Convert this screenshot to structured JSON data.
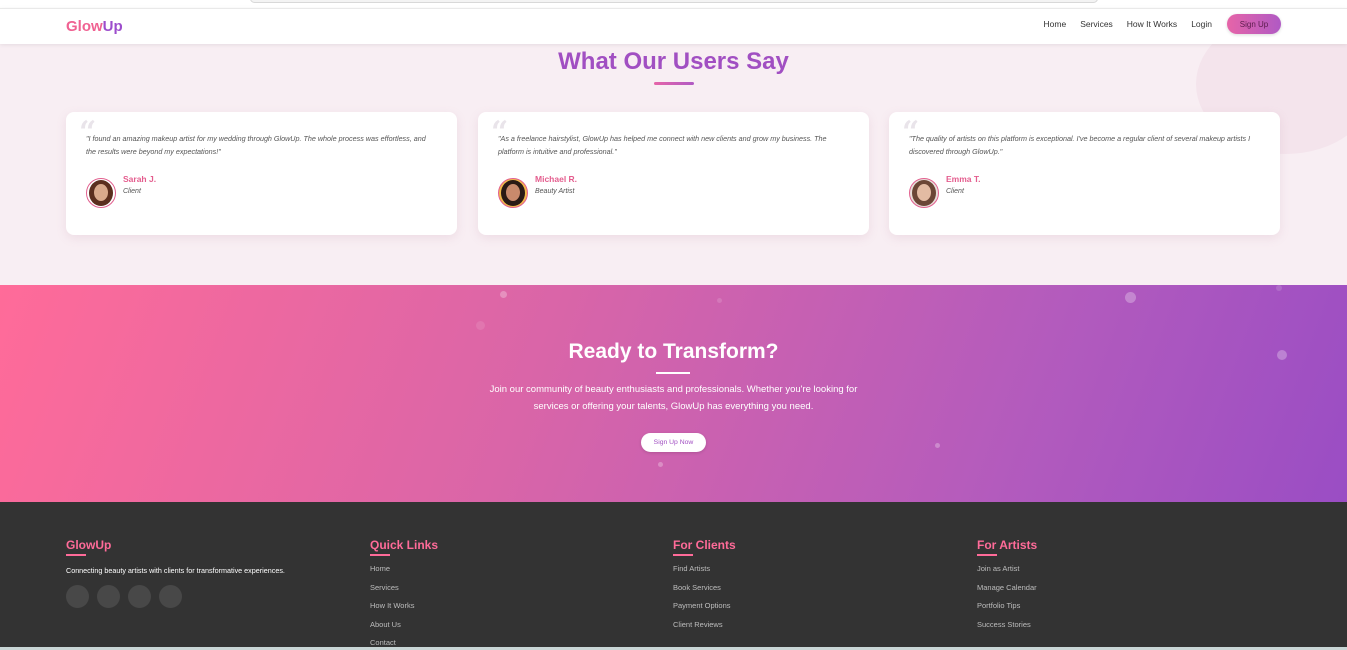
{
  "navbar": {
    "logo_part1": "Glow",
    "logo_part2": "Up",
    "links": [
      "Home",
      "Services",
      "How It Works",
      "Login"
    ],
    "signup_label": "Sign Up"
  },
  "testimonials": {
    "title": "What Our Users Say",
    "items": [
      {
        "quote": "\"I found an amazing makeup artist for my wedding through GlowUp. The whole process was effortless, and the results were beyond my expectations!\"",
        "name": "Sarah J.",
        "role": "Client"
      },
      {
        "quote": "\"As a freelance hairstylist, GlowUp has helped me connect with new clients and grow my business. The platform is intuitive and professional.\"",
        "name": "Michael R.",
        "role": "Beauty Artist"
      },
      {
        "quote": "\"The quality of artists on this platform is exceptional. I've become a regular client of several makeup artists I discovered through GlowUp.\"",
        "name": "Emma T.",
        "role": "Client"
      }
    ]
  },
  "cta": {
    "title": "Ready to Transform?",
    "text": "Join our community of beauty enthusiasts and professionals. Whether you're looking for services or offering your talents, GlowUp has everything you need.",
    "button_label": "Sign Up Now"
  },
  "footer": {
    "brand": {
      "heading": "GlowUp",
      "tagline": "Connecting beauty artists with clients for transformative experiences."
    },
    "quick_links": {
      "heading": "Quick Links",
      "links": [
        "Home",
        "Services",
        "How It Works",
        "About Us",
        "Contact"
      ]
    },
    "for_clients": {
      "heading": "For Clients",
      "links": [
        "Find Artists",
        "Book Services",
        "Payment Options",
        "Client Reviews"
      ]
    },
    "for_artists": {
      "heading": "For Artists",
      "links": [
        "Join as Artist",
        "Manage Calendar",
        "Portfolio Tips",
        "Success Stories"
      ]
    }
  },
  "colors": {
    "brand_pink": "#f06292",
    "brand_purple": "#9c4dcc",
    "footer_bg": "#333333",
    "testimonial_bg": "#f8eef3"
  }
}
